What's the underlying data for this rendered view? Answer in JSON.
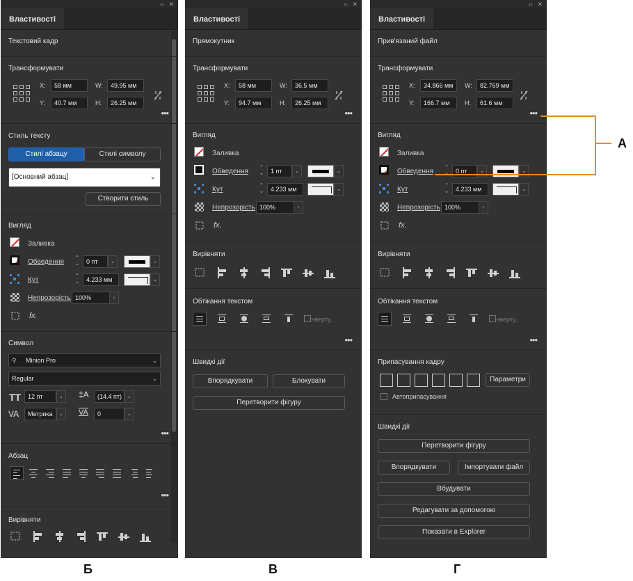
{
  "panel_b": {
    "tab": "Властивості",
    "section_title": "Текстовий кадр",
    "transform": {
      "heading": "Трансформувати",
      "x_label": "X:",
      "x": "58 мм",
      "y_label": "Y:",
      "y": "40.7 мм",
      "w_label": "W:",
      "w": "49.95 мм",
      "h_label": "H:",
      "h": "26.25 мм"
    },
    "text_style": {
      "heading": "Стиль тексту",
      "tab_para": "Стилі абзацу",
      "tab_char": "Стилі символу",
      "selected": "[Основний абзац]",
      "create_btn": "Створити стиль"
    },
    "appearance": {
      "heading": "Вигляд",
      "fill": "Заливка",
      "stroke": "Обведення",
      "stroke_value": "0 пт",
      "corner": "Кут",
      "corner_value": "4.233 мм",
      "opacity": "Непрозорість",
      "opacity_value": "100%",
      "fx": "fx."
    },
    "character": {
      "heading": "Символ",
      "font": "Minion Pro",
      "style": "Regular",
      "size": "12 пт",
      "leading": "(14.4 пт)",
      "kerning": "Метрика",
      "tracking": "0"
    },
    "paragraph": {
      "heading": "Абзац"
    },
    "align": {
      "heading": "Вирівняти"
    },
    "dots": "•••",
    "caption": "Б"
  },
  "panel_v": {
    "tab": "Властивості",
    "section_title": "Прямокутник",
    "transform": {
      "heading": "Трансформувати",
      "x_label": "X:",
      "x": "58 мм",
      "y_label": "Y:",
      "y": "94.7 мм",
      "w_label": "W:",
      "w": "36.5 мм",
      "h_label": "H:",
      "h": "26.25 мм"
    },
    "appearance": {
      "heading": "Вигляд",
      "fill": "Заливка",
      "stroke": "Обведення",
      "stroke_value": "1 пт",
      "corner": "Кут",
      "corner_value": "4.233 мм",
      "opacity": "Непрозорість",
      "opacity_value": "100%",
      "fx": "fx."
    },
    "align": {
      "heading": "Вирівняти"
    },
    "text_wrap": {
      "heading": "Обтікання текстом",
      "invert": "Інверту..."
    },
    "quick_actions": {
      "heading": "Швидкі дії",
      "arrange": "Впорядкувати",
      "lock": "Блокувати",
      "convert_shape": "Перетворити фігуру"
    },
    "dots": "•••",
    "caption": "В"
  },
  "panel_g": {
    "tab": "Властивості",
    "section_title": "Прив'язаний файл",
    "transform": {
      "heading": "Трансформувати",
      "x_label": "X:",
      "x": "34.866 мм",
      "y_label": "Y:",
      "y": "166.7 мм",
      "w_label": "W:",
      "w": "82.769 мм",
      "h_label": "H:",
      "h": "61.6 мм"
    },
    "appearance": {
      "heading": "Вигляд",
      "fill": "Заливка",
      "stroke": "Обведення",
      "stroke_value": "0 пт",
      "corner": "Кут",
      "corner_value": "4.233 мм",
      "opacity": "Непрозорість",
      "opacity_value": "100%",
      "fx": "fx."
    },
    "align": {
      "heading": "Вирівняти"
    },
    "text_wrap": {
      "heading": "Обтікання текстом",
      "invert": "Інверту..."
    },
    "frame_fitting": {
      "heading": "Припасування кадру",
      "params": "Параметри",
      "auto_fit": "Автоприпасування"
    },
    "quick_actions": {
      "heading": "Швидкі дії",
      "convert_shape": "Перетворити фігуру",
      "arrange": "Впорядкувати",
      "import_file": "Імпортувати файл",
      "embed": "Вбудувати",
      "edit_with": "Редагувати за допомогою",
      "show_explorer": "Показати в Explorer"
    },
    "dots": "•••",
    "caption": "Г"
  },
  "callout_label": "А",
  "window_controls": {
    "collapse": "‹‹",
    "close": "✕"
  }
}
